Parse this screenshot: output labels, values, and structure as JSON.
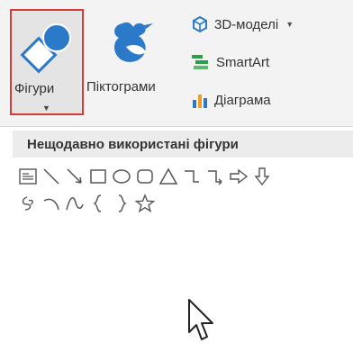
{
  "ribbon": {
    "shapes_button": {
      "label": "Фігури",
      "icon": "shapes-icon",
      "dropdown_icon": "chevron-down-icon"
    },
    "icons_button": {
      "label": "Піктограми",
      "icon": "bird-icon"
    },
    "models_button": {
      "label": "3D-моделі",
      "icon": "cube-icon",
      "dropdown_icon": "chevron-down-icon"
    },
    "smartart_button": {
      "label": "SmartArt",
      "icon": "smartart-icon"
    },
    "chart_button": {
      "label": "Діаграма",
      "icon": "bar-chart-icon"
    }
  },
  "shapes_gallery": {
    "section_title": "Нещодавно використані фігури",
    "shapes": [
      "text-box",
      "line",
      "arrow-line",
      "rectangle",
      "oval",
      "rounded-rectangle",
      "triangle",
      "elbow-connector",
      "elbow-arrow-connector",
      "right-arrow",
      "down-arrow",
      "freeform-scribble",
      "arc",
      "curve",
      "left-brace",
      "right-brace",
      "star"
    ]
  },
  "colors": {
    "highlight": "#d63b3b",
    "accent": "#2b79c9",
    "orange": "#f29b1d"
  }
}
